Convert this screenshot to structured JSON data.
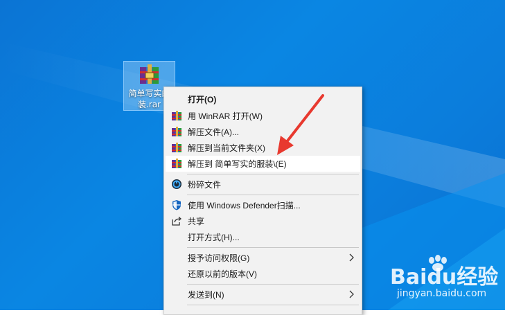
{
  "desktop": {
    "file": {
      "name": "简单写实的服装.rar",
      "label_line1": "简单写实的",
      "label_line2": "装.rar",
      "icon": "winrar-archive-icon"
    }
  },
  "context_menu": {
    "items": [
      {
        "label": "打开(O)",
        "icon": null,
        "bold": true
      },
      {
        "label": "用 WinRAR 打开(W)",
        "icon": "winrar-icon"
      },
      {
        "label": "解压文件(A)...",
        "icon": "winrar-icon"
      },
      {
        "label": "解压到当前文件夹(X)",
        "icon": "winrar-icon"
      },
      {
        "label": "解压到 简单写实的服装\\(E)",
        "icon": "winrar-icon",
        "highlighted": true
      },
      {
        "label": "粉碎文件",
        "icon": "shredder-icon"
      },
      {
        "label": "使用 Windows Defender扫描...",
        "icon": "defender-shield-icon"
      },
      {
        "label": "共享",
        "icon": "share-icon"
      },
      {
        "label": "打开方式(H)...",
        "icon": null
      },
      {
        "label": "授予访问权限(G)",
        "icon": null,
        "submenu": true
      },
      {
        "label": "还原以前的版本(V)",
        "icon": null
      },
      {
        "label": "发送到(N)",
        "icon": null,
        "submenu": true
      }
    ]
  },
  "watermark": {
    "brand": "Baidu经验",
    "url": "jingyan.baidu.com"
  },
  "colors": {
    "desktop_blue": "#0b7ddc",
    "menu_bg": "#f2f2f2",
    "highlight": "#ffffff",
    "annotation_arrow": "#e8392f"
  }
}
